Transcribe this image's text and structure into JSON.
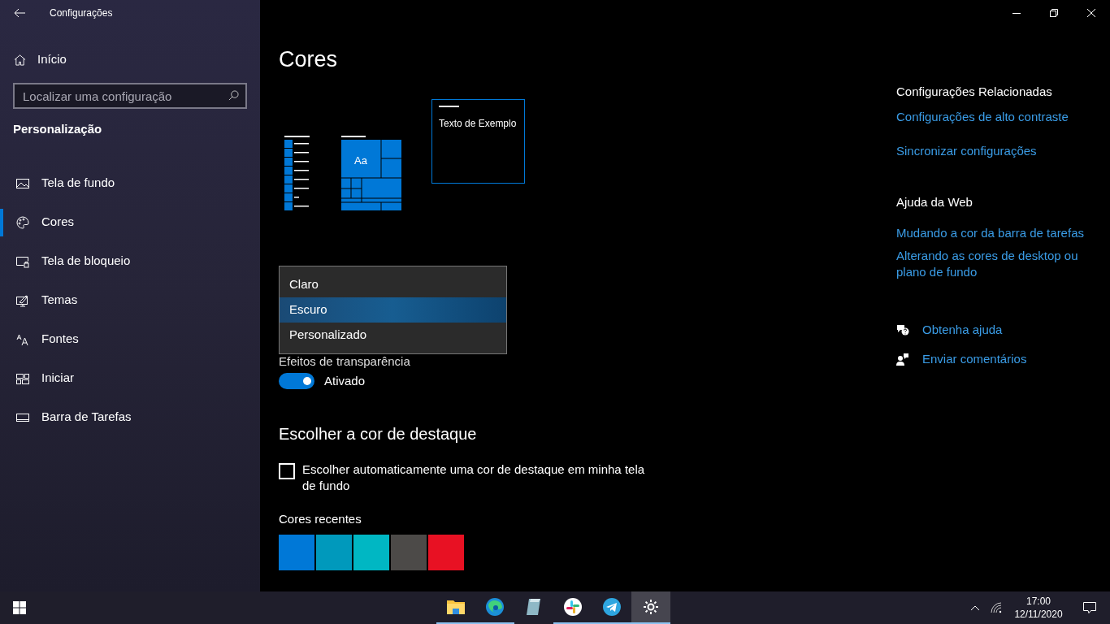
{
  "window": {
    "title": "Configurações"
  },
  "sidebar": {
    "home": "Início",
    "search": {
      "placeholder": "Localizar uma configuração"
    },
    "section": "Personalização",
    "items": [
      {
        "label": "Tela de fundo",
        "kind": "picture",
        "selected": false
      },
      {
        "label": "Cores",
        "kind": "palette",
        "selected": true
      },
      {
        "label": "Tela de bloqueio",
        "kind": "lock",
        "selected": false
      },
      {
        "label": "Temas",
        "kind": "themes",
        "selected": false
      },
      {
        "label": "Fontes",
        "kind": "fonts",
        "selected": false
      },
      {
        "label": "Iniciar",
        "kind": "start",
        "selected": false
      },
      {
        "label": "Barra de Tarefas",
        "kind": "taskbar",
        "selected": false
      }
    ]
  },
  "page": {
    "title": "Cores",
    "preview": {
      "tile_text": "Aa",
      "sample_text": "Texto de Exemplo"
    },
    "color_menu": {
      "options": [
        {
          "label": "Claro",
          "selected": false
        },
        {
          "label": "Escuro",
          "selected": true
        },
        {
          "label": "Personalizado",
          "selected": false
        }
      ]
    },
    "transparency": {
      "label": "Efeitos de transparência",
      "on": true,
      "state_text": "Ativado"
    },
    "accent": {
      "heading": "Escolher a cor de destaque",
      "auto_checkbox": {
        "label": "Escolher automaticamente uma cor de destaque em minha tela de fundo",
        "checked": false
      },
      "recent_label": "Cores recentes",
      "recent_colors": [
        {
          "color": "#0078d7"
        },
        {
          "color": "#0099bc"
        },
        {
          "color": "#00b7c3"
        },
        {
          "color": "#4c4a48"
        },
        {
          "color": "#e81123"
        }
      ]
    }
  },
  "related": {
    "heading": "Configurações Relacionadas",
    "links": [
      "Configurações de alto contraste",
      "Sincronizar configurações"
    ]
  },
  "web_help": {
    "heading": "Ajuda da Web",
    "links": [
      "Mudando a cor da barra de tarefas",
      "Alterando as cores de desktop ou plano de fundo"
    ]
  },
  "support": [
    {
      "kind": "help",
      "label": "Obtenha ajuda"
    },
    {
      "kind": "feedback",
      "label": "Enviar comentários"
    }
  ],
  "taskbar": {
    "apps": [
      {
        "kind": "folder",
        "running": true,
        "selected": false
      },
      {
        "kind": "browser",
        "running": true,
        "selected": false
      },
      {
        "kind": "notepad",
        "running": false,
        "selected": false
      },
      {
        "kind": "slack",
        "running": true,
        "selected": false
      },
      {
        "kind": "telegram",
        "running": true,
        "selected": false
      },
      {
        "kind": "settings",
        "running": true,
        "selected": true
      }
    ],
    "time": "17:00",
    "date": "12/11/2020"
  }
}
